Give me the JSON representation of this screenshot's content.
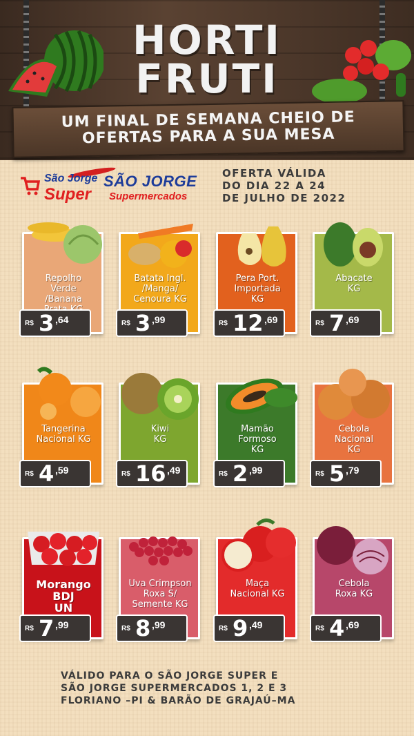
{
  "header": {
    "title_line1": "HORTI",
    "title_line2": "FRUTI",
    "subtitle_line1": "UM FINAL DE SEMANA CHEIO DE",
    "subtitle_line2": "OFERTAS PARA A SUA MESA"
  },
  "logos": {
    "logo1_line1": "São Jorge",
    "logo1_line2": "Super",
    "logo2_line1": "SÃO JORGE",
    "logo2_line2": "Supermercados"
  },
  "validity": {
    "line1": "OFERTA VÁLIDA",
    "line2": "DO DIA 22 A 24",
    "line3": "DE JULHO DE 2022"
  },
  "currency": "R$",
  "products": [
    {
      "name": [
        "Repolho",
        "Verde",
        "/Banana",
        "Prata KG"
      ],
      "int": "3",
      "dec": ",64",
      "color": "#e9a777"
    },
    {
      "name": [
        "Batata Ingl.",
        "/Manga/",
        "Cenoura KG"
      ],
      "int": "3",
      "dec": ",99",
      "color": "#f2a81b"
    },
    {
      "name": [
        "Pera Port.",
        "Importada",
        "KG"
      ],
      "int": "12",
      "dec": ",69",
      "color": "#e2611e"
    },
    {
      "name": [
        "Abacate",
        "KG"
      ],
      "int": "7",
      "dec": ",69",
      "color": "#a4b949"
    },
    {
      "name": [
        "Tangerina",
        "Nacional KG"
      ],
      "int": "4",
      "dec": ",59",
      "color": "#f08719"
    },
    {
      "name": [
        "Kiwi",
        "KG"
      ],
      "int": "16",
      "dec": ",49",
      "color": "#7ea62f"
    },
    {
      "name": [
        "Mamão",
        "Formoso",
        "KG"
      ],
      "int": "2",
      "dec": ",99",
      "color": "#3c7a2a"
    },
    {
      "name": [
        "Cebola",
        "Nacional",
        "KG"
      ],
      "int": "5",
      "dec": ",79",
      "color": "#e8733f"
    },
    {
      "name": [
        "Morango",
        "BDJ",
        "UN"
      ],
      "int": "7",
      "dec": ",99",
      "color": "#c8121a"
    },
    {
      "name": [
        "Uva Crimpson",
        "Roxa S/",
        "Semente KG"
      ],
      "int": "8",
      "dec": ",99",
      "color": "#d95d6a"
    },
    {
      "name": [
        "Maça",
        "Nacional KG"
      ],
      "int": "9",
      "dec": ",49",
      "color": "#e32b2b"
    },
    {
      "name": [
        "Cebola",
        "Roxa KG"
      ],
      "int": "4",
      "dec": ",69",
      "color": "#b7476a"
    }
  ],
  "footer": {
    "line1": "VÁLIDO PARA O SÃO JORGE SUPER E",
    "line2": "SÃO JORGE SUPERMERCADOS 1, 2 E 3",
    "line3": "FLORIANO –PI & BARÃO DE GRAJAÚ–MA"
  }
}
